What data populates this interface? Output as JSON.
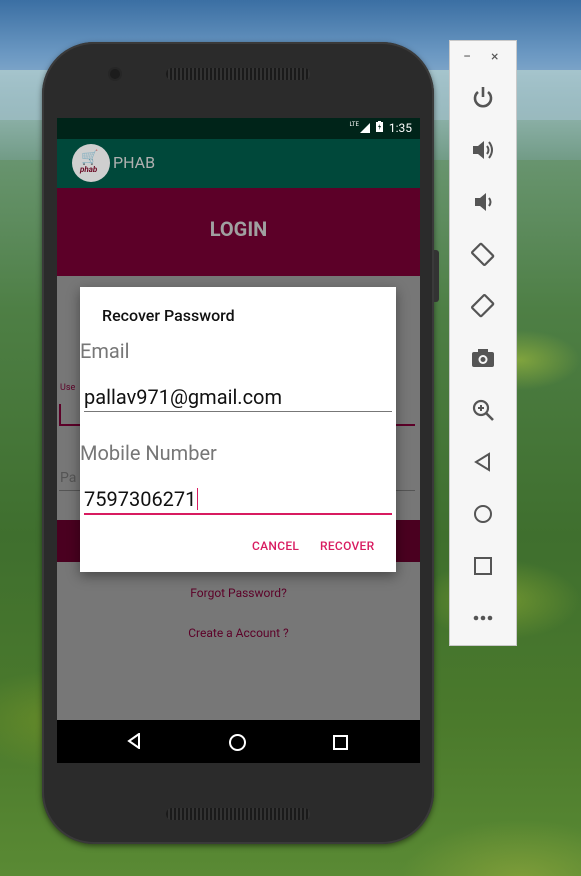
{
  "status": {
    "network": "LTE",
    "time": "1:35"
  },
  "app": {
    "title": "PHAB",
    "logo_text": "phab"
  },
  "login": {
    "header": "LOGIN",
    "username_label": "Use",
    "password_hint": "Pa",
    "forgot_link": "Forgot Password?",
    "create_link": "Create a Account ?"
  },
  "dialog": {
    "title": "Recover Password",
    "email_label": "Email",
    "email_value": "pallav971@gmail.com",
    "mobile_label": "Mobile Number",
    "mobile_value": "7597306271",
    "cancel_label": "CANCEL",
    "recover_label": "RECOVER"
  },
  "emulator": {
    "minimize": "−",
    "close": "×",
    "controls": [
      "power-icon",
      "volume-up-icon",
      "volume-down-icon",
      "rotate-left-icon",
      "rotate-right-icon",
      "camera-icon",
      "zoom-icon",
      "back-icon",
      "home-icon",
      "overview-icon",
      "more-icon"
    ]
  },
  "colors": {
    "accent": "#d81b60",
    "primary_dark": "#00483a",
    "maroon": "#5c0028"
  }
}
